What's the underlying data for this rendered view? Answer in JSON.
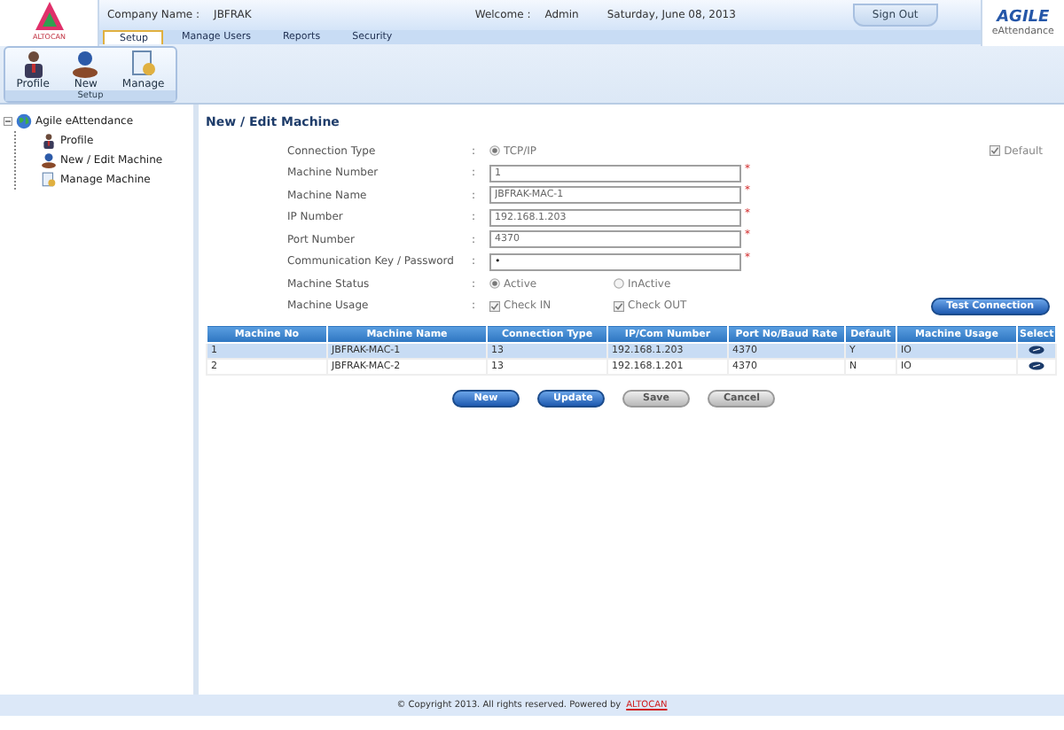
{
  "header": {
    "logo_text": "ALTOCAN",
    "company_label": "Company Name :",
    "company": "JBFRAK",
    "welcome_label": "Welcome :",
    "user": "Admin",
    "date": "Saturday, June 08, 2013",
    "sign_out": "Sign Out",
    "brand": "AGILE",
    "brand_sub": "eAttendance"
  },
  "tabs": [
    {
      "label": "Setup",
      "selected": true
    },
    {
      "label": "Manage Users",
      "selected": false
    },
    {
      "label": "Reports",
      "selected": false
    },
    {
      "label": "Security",
      "selected": false
    }
  ],
  "ribbon": {
    "group": "Setup",
    "buttons": [
      {
        "label": "Profile",
        "kind": "profile"
      },
      {
        "label": "New",
        "kind": "new"
      },
      {
        "label": "Manage",
        "kind": "manage"
      }
    ]
  },
  "tree": {
    "label": "Agile eAttendance",
    "expanded": true,
    "children": [
      {
        "label": "Profile",
        "kind": "profile"
      },
      {
        "label": "New / Edit Machine",
        "kind": "new"
      },
      {
        "label": "Manage Machine",
        "kind": "manage"
      }
    ]
  },
  "form": {
    "title": "New / Edit Machine",
    "colon": ":",
    "fields": [
      {
        "kind": "radio",
        "label": "Connection Type",
        "options": [
          {
            "label": "TCP/IP",
            "selected": true
          }
        ],
        "extra": {
          "label": "Default",
          "checked": true
        }
      },
      {
        "kind": "text",
        "label": "Machine Number",
        "value": "1",
        "disabled": true,
        "mark": "*"
      },
      {
        "kind": "text",
        "label": "Machine Name",
        "value": "JBFRAK-MAC-1",
        "disabled": true,
        "mark": "*"
      },
      {
        "kind": "text",
        "label": "IP Number",
        "value": "192.168.1.203",
        "disabled": true,
        "mark": "*"
      },
      {
        "kind": "text",
        "label": "Port Number",
        "value": "4370",
        "disabled": true,
        "mark": "*"
      },
      {
        "kind": "text",
        "label": "Communication Key / Password",
        "value": "•",
        "disabled": false,
        "mark": "*"
      },
      {
        "kind": "radio",
        "label": "Machine Status",
        "options": [
          {
            "label": "Active",
            "selected": true
          },
          {
            "label": "InActive",
            "selected": false
          }
        ]
      },
      {
        "kind": "checkbox",
        "label": "Machine Usage",
        "options": [
          {
            "label": "Check IN",
            "checked": true
          },
          {
            "label": "Check OUT",
            "checked": true
          }
        ],
        "button": "Test Connection"
      }
    ]
  },
  "table": {
    "columns": [
      "Machine No",
      "Machine Name",
      "Connection Type",
      "IP/Com Number",
      "Port No/Baud Rate",
      "Default",
      "Machine Usage",
      "Select"
    ],
    "rows": [
      {
        "selected": true,
        "cells": [
          "1",
          "JBFRAK-MAC-1",
          "13",
          "192.168.1.203",
          "4370",
          "Y",
          "IO"
        ]
      },
      {
        "selected": false,
        "cells": [
          "2",
          "JBFRAK-MAC-2",
          "13",
          "192.168.1.201",
          "4370",
          "N",
          "IO"
        ]
      }
    ]
  },
  "buttons": [
    {
      "label": "New",
      "disabled": false
    },
    {
      "label": "Update",
      "disabled": false
    },
    {
      "label": "Save",
      "disabled": true
    },
    {
      "label": "Cancel",
      "disabled": true
    }
  ],
  "footer": {
    "text": "© Copyright 2013. All rights reserved. Powered by",
    "link": "ALTOCAN"
  }
}
